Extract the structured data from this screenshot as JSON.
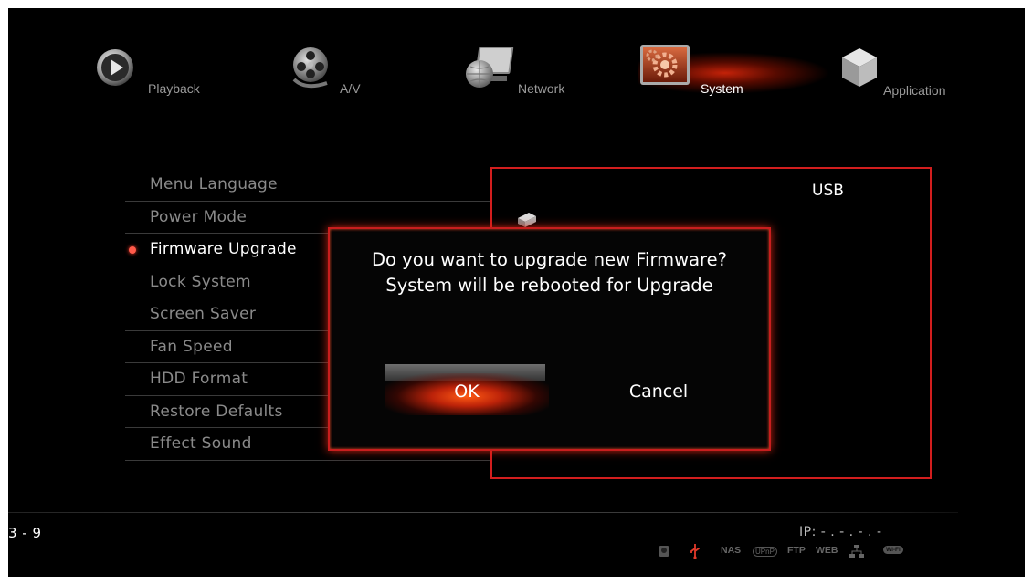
{
  "topnav": {
    "items": [
      {
        "label": "Playback",
        "icon": "play-icon"
      },
      {
        "label": "A/V",
        "icon": "film-reel-icon"
      },
      {
        "label": "Network",
        "icon": "network-globe-icon"
      },
      {
        "label": "System",
        "icon": "system-gear-icon",
        "active": true
      },
      {
        "label": "Application",
        "icon": "cube-icon"
      }
    ]
  },
  "settings": {
    "items": [
      {
        "label": "Menu Language"
      },
      {
        "label": "Power Mode"
      },
      {
        "label": "Firmware Upgrade",
        "selected": true
      },
      {
        "label": "Lock System"
      },
      {
        "label": "Screen Saver"
      },
      {
        "label": "Fan Speed"
      },
      {
        "label": "HDD Format"
      },
      {
        "label": "Restore Defaults"
      },
      {
        "label": "Effect Sound"
      }
    ]
  },
  "info_panel": {
    "title": "USB",
    "icon": "usb-drive-icon"
  },
  "dialog": {
    "message_line1": "Do you want to upgrade new Firmware?",
    "message_line2": "System will be rebooted for Upgrade",
    "ok_label": "OK",
    "cancel_label": "Cancel"
  },
  "footer": {
    "page_indicator": "3 - 9",
    "ip": "IP: - . - . - . -",
    "status_icons": [
      {
        "name": "hdd-status-icon",
        "label": ""
      },
      {
        "name": "usb-status-icon",
        "label": ""
      },
      {
        "name": "nas-status",
        "label": "NAS"
      },
      {
        "name": "upnp-status",
        "label": "UPnP"
      },
      {
        "name": "ftp-status",
        "label": "FTP"
      },
      {
        "name": "web-status",
        "label": "WEB"
      },
      {
        "name": "lan-status-icon",
        "label": ""
      },
      {
        "name": "wifi-status-icon",
        "label": "Wi-Fi"
      }
    ]
  },
  "colors": {
    "accent_red": "#d21e1e",
    "background": "#000000",
    "text_active": "#ffffff",
    "text_inactive": "#8a8a8a"
  }
}
